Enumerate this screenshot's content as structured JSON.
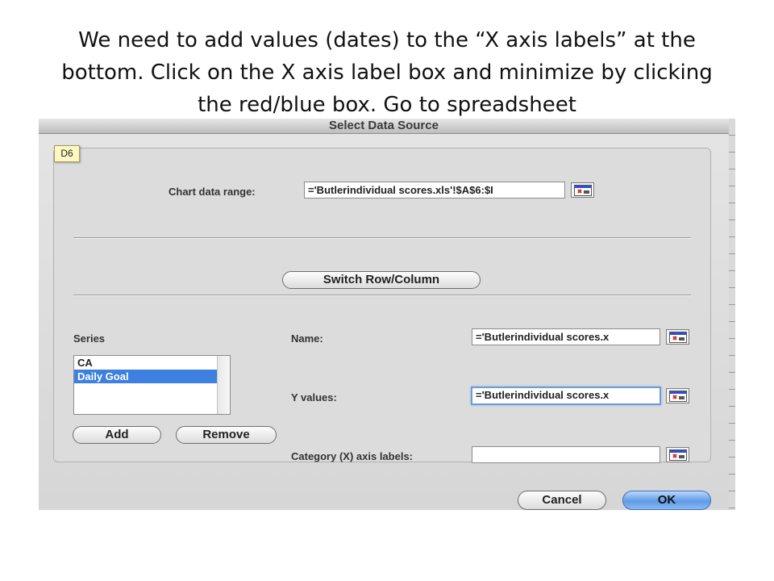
{
  "caption": {
    "line1": "We need to add values (dates) to the “X axis labels” at the",
    "line2": "bottom.  Click on the X axis label box and minimize by clicking",
    "line3": "the red/blue box.  Go to spreadsheet"
  },
  "dialog": {
    "title": "Select Data Source",
    "cell_tooltip": "D6",
    "chart_range": {
      "label": "Chart data range:",
      "value": "='Butlerindividual scores.xls'!$A$6:$I",
      "button_icon": "collapse-dialog-icon"
    },
    "switch_button": "Switch Row/Column",
    "series": {
      "label": "Series",
      "items": [
        "CA",
        "Daily Goal"
      ],
      "selected_index": 1,
      "add_label": "Add",
      "remove_label": "Remove"
    },
    "name": {
      "label": "Name:",
      "value": "='Butlerindividual scores.x"
    },
    "y_values": {
      "label": "Y values:",
      "value": "='Butlerindividual scores.x"
    },
    "x_axis_labels": {
      "label": "Category (X) axis labels:",
      "value": ""
    },
    "cancel_label": "Cancel",
    "ok_label": "OK"
  },
  "colors": {
    "accent": "#3d80df",
    "ok_button": "#5f9be7",
    "collapse_icon_red": "#d42a2a",
    "collapse_icon_blue": "#2a4fd4"
  }
}
